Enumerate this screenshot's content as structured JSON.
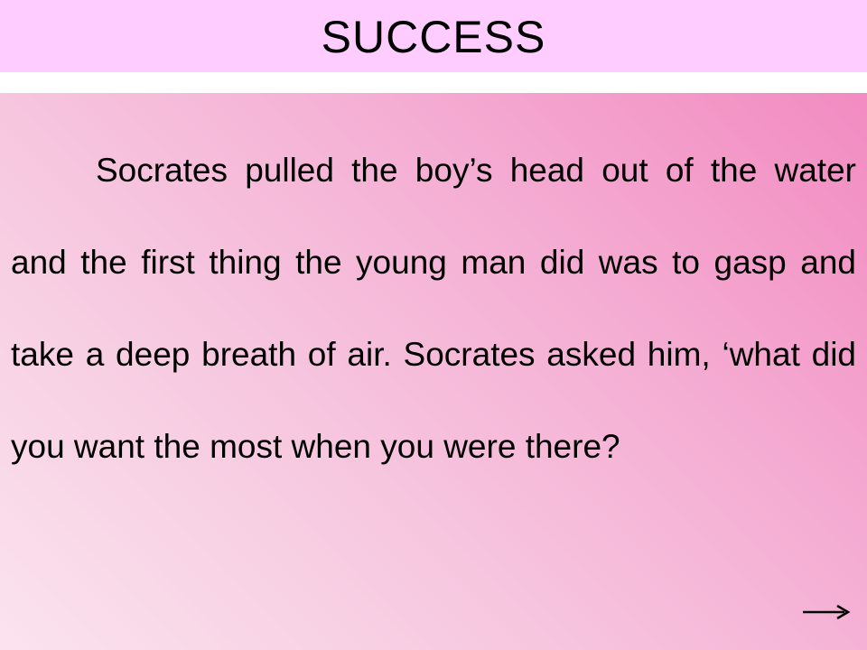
{
  "slide": {
    "title": "SUCCESS",
    "body": "Socrates pulled the boy’s head out of the water and the first thing the young man did was to gasp and take a deep breath of air. Socrates asked him, ‘what did you want the most when you were there?"
  },
  "colors": {
    "title_band": "#ffccff",
    "panel_gradient_start": "#f28bc1",
    "panel_gradient_end": "#fbe3ee",
    "text": "#000000"
  },
  "icons": {
    "next": "right-arrow-icon"
  }
}
